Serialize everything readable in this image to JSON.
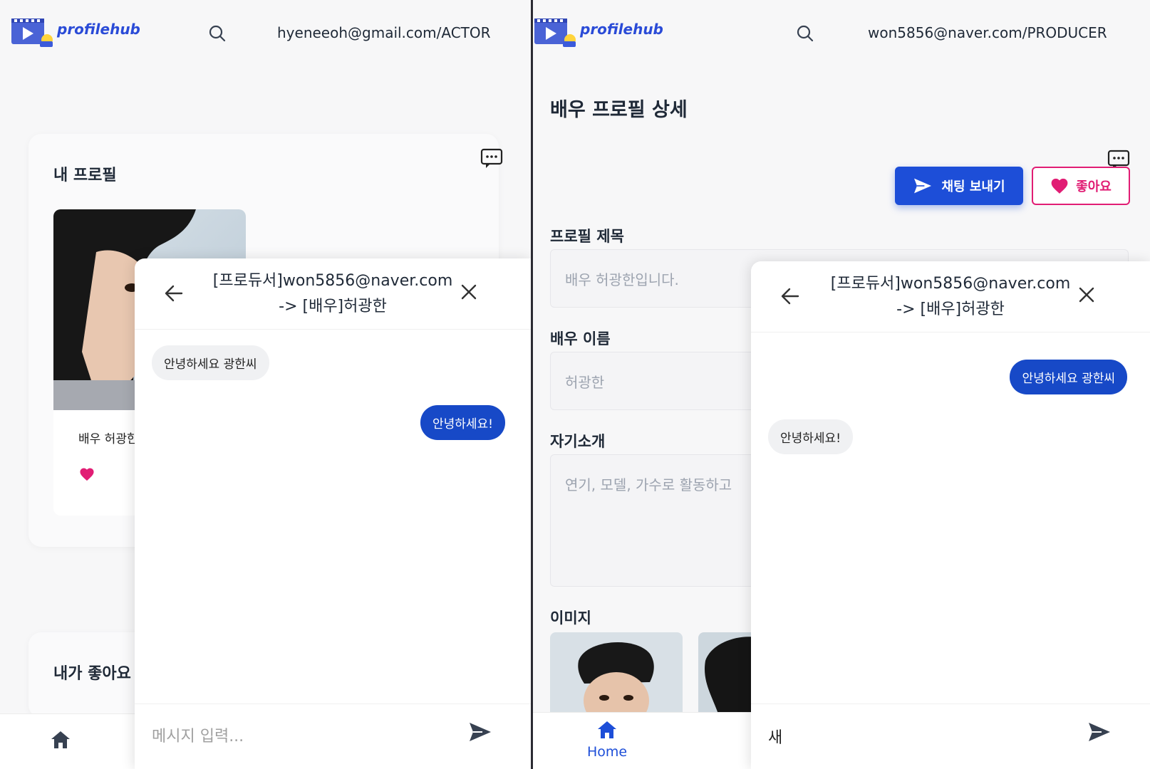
{
  "left": {
    "brand": "profilehub",
    "account": "hyeneeoh@gmail.com/ACTOR",
    "my_profile_title": "내 프로필",
    "profile_name": "배우 허광한",
    "liked_title": "내가 좋아요",
    "chat": {
      "title_line1": "[프로듀서]won5856@naver.com",
      "title_line2": "-> [배우]허광한",
      "messages": [
        {
          "dir": "in",
          "text": "안녕하세요 광한씨"
        },
        {
          "dir": "out",
          "text": "안녕하세요!"
        }
      ],
      "input_value": "",
      "input_placeholder": "메시지 입력..."
    }
  },
  "right": {
    "brand": "profilehub",
    "account": "won5856@naver.com/PRODUCER",
    "page_title": "배우 프로필 상세",
    "send_chat_button": "채팅 보내기",
    "like_button": "좋아요",
    "fields": {
      "title_label": "프로필 제목",
      "title_value": "배우 허광한입니다.",
      "name_label": "배우 이름",
      "name_value": "허광한",
      "intro_label": "자기소개",
      "intro_value": "연기, 모델, 가수로 활동하고",
      "images_label": "이미지"
    },
    "nav_home": "Home",
    "chat": {
      "title_line1": "[프로듀서]won5856@naver.com",
      "title_line2": "-> [배우]허광한",
      "messages": [
        {
          "dir": "out",
          "text": "안녕하세요 광한씨"
        },
        {
          "dir": "in",
          "text": "안녕하세요!"
        }
      ],
      "input_value": "새"
    }
  },
  "colors": {
    "accent": "#1d4ed8",
    "bubble_out": "#1749c7",
    "like_pink": "#e11d74",
    "brand_blue": "#2a4bd7"
  }
}
